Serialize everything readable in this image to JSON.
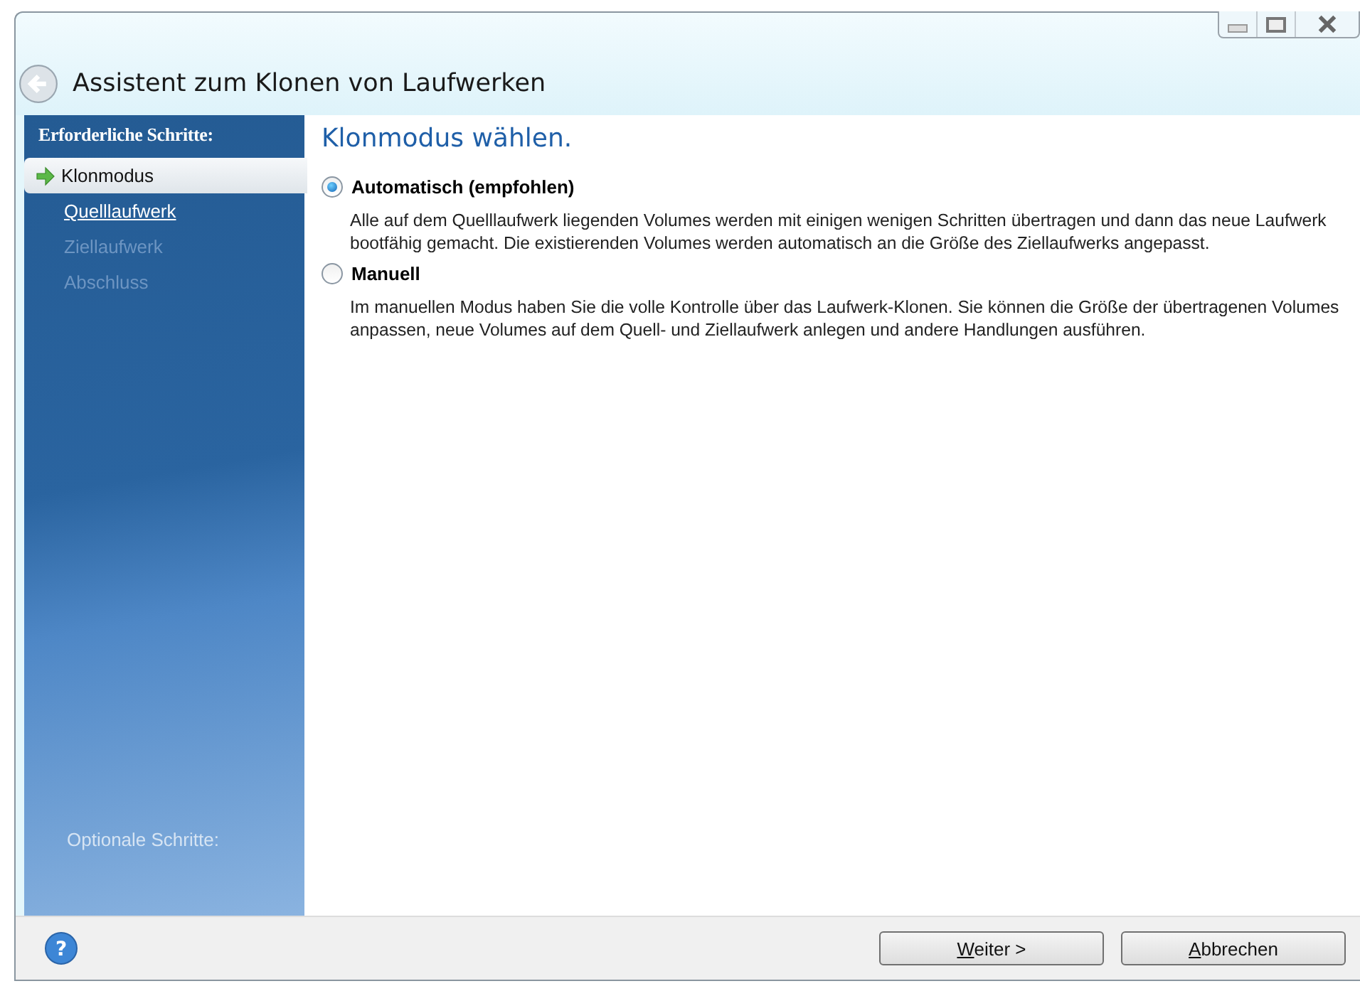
{
  "window": {
    "title": "Assistent zum Klonen von Laufwerken"
  },
  "sidebar": {
    "heading": "Erforderliche Schritte:",
    "steps": [
      {
        "label": "Klonmodus",
        "kind": "current"
      },
      {
        "label": "Quelllaufwerk",
        "kind": "link"
      },
      {
        "label": "Ziellaufwerk",
        "kind": "disabled"
      },
      {
        "label": "Abschluss",
        "kind": "disabled"
      }
    ],
    "optional_heading": "Optionale Schritte:"
  },
  "content": {
    "heading": "Klonmodus wählen.",
    "options": [
      {
        "label": "Automatisch (empfohlen)",
        "selected": true,
        "description": "Alle auf dem Quelllaufwerk liegenden Volumes werden mit einigen wenigen Schritten übertragen und dann das neue Laufwerk bootfähig gemacht. Die existierenden Volumes werden automatisch an die Größe des Ziellaufwerks angepasst."
      },
      {
        "label": "Manuell",
        "selected": false,
        "description": "Im manuellen Modus haben Sie die volle Kontrolle über das Laufwerk-Klonen. Sie können die Größe der übertragenen Volumes anpassen, neue Volumes auf dem Quell- und Ziellaufwerk anlegen und andere Handlungen ausführen."
      }
    ]
  },
  "help": {
    "glyph": "?"
  },
  "buttons": [
    {
      "accel": "W",
      "rest": "eiter >"
    },
    {
      "accel": "A",
      "rest": "bbrechen"
    }
  ]
}
